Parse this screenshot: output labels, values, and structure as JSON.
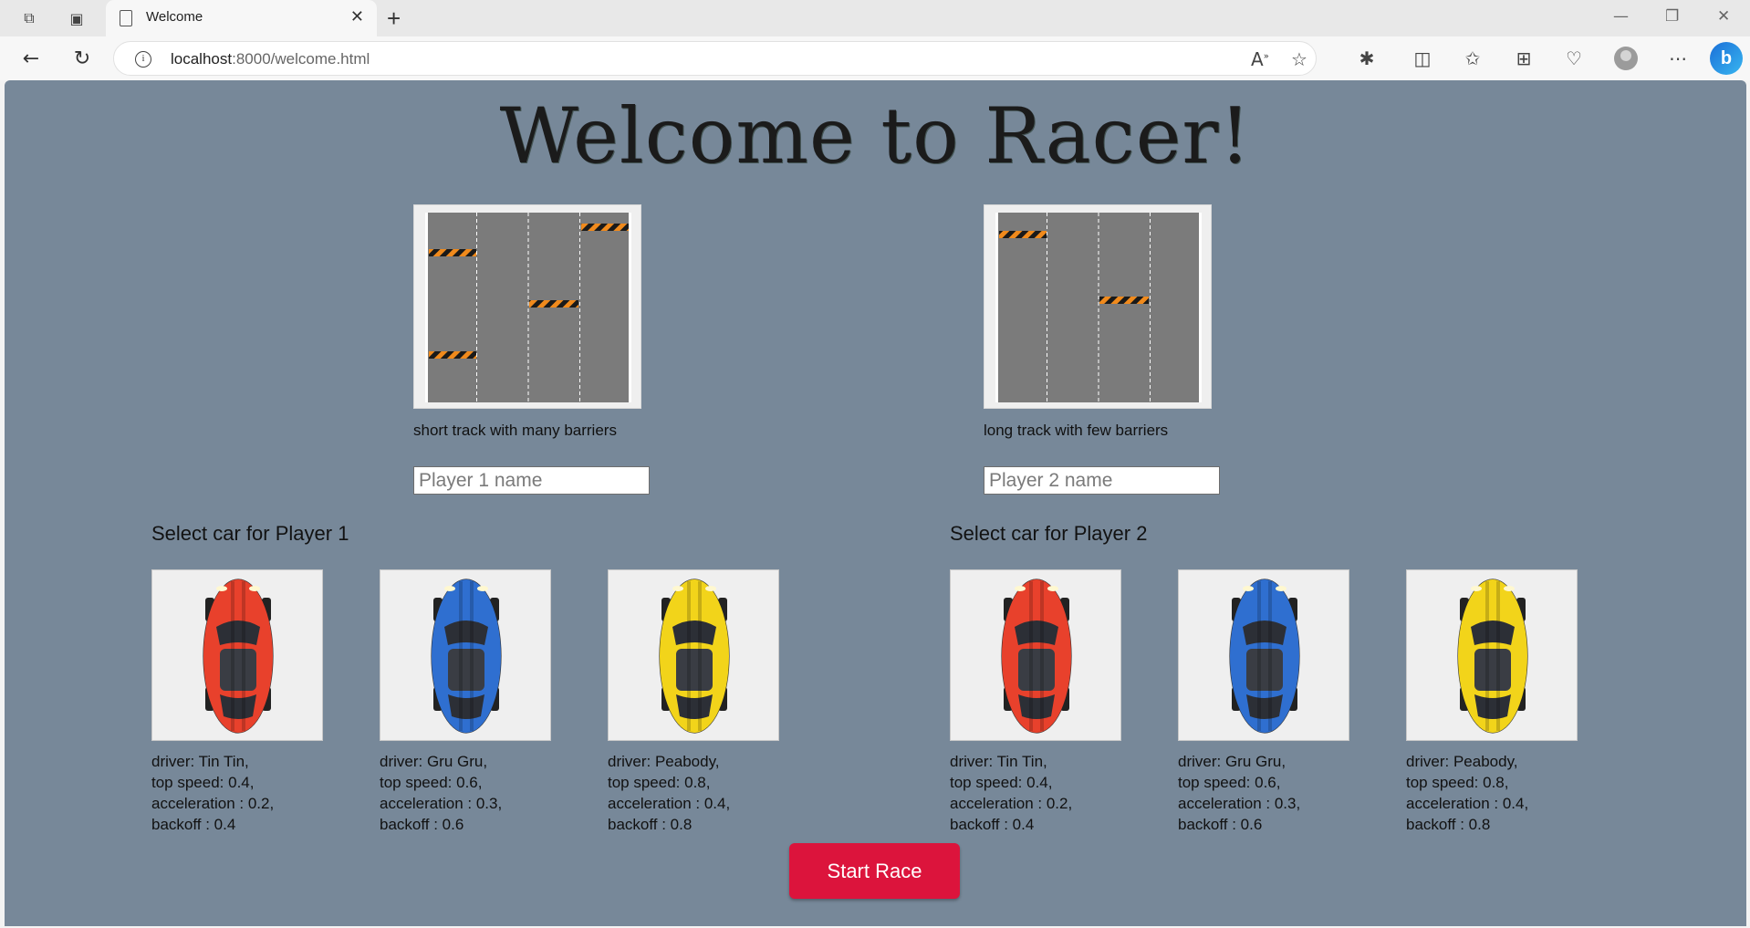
{
  "browser": {
    "tab_title": "Welcome",
    "url_host": "localhost",
    "url_path": ":8000/welcome.html"
  },
  "page": {
    "title": "Welcome to Racer!",
    "tracks": [
      {
        "caption": "short track with many barriers",
        "barrier_lanes": [
          0,
          2,
          3,
          0
        ]
      },
      {
        "caption": "long track with few barriers"
      }
    ],
    "players": [
      {
        "placeholder": "Player 1 name",
        "select_label": "Select car for Player 1"
      },
      {
        "placeholder": "Player 2 name",
        "select_label": "Select car for Player 2"
      }
    ],
    "cars": [
      {
        "color": "#e8412c",
        "line1": "driver: Tin Tin,",
        "line2": "top speed: 0.4,",
        "line3": "acceleration : 0.2,",
        "line4": "backoff : 0.4"
      },
      {
        "color": "#2f6fd0",
        "line1": "driver: Gru Gru,",
        "line2": "top speed: 0.6,",
        "line3": "acceleration : 0.3,",
        "line4": "backoff : 0.6"
      },
      {
        "color": "#f2d41a",
        "line1": "driver: Peabody,",
        "line2": "top speed: 0.8,",
        "line3": "acceleration : 0.4,",
        "line4": "backoff : 0.8"
      }
    ],
    "start_button": "Start Race"
  }
}
